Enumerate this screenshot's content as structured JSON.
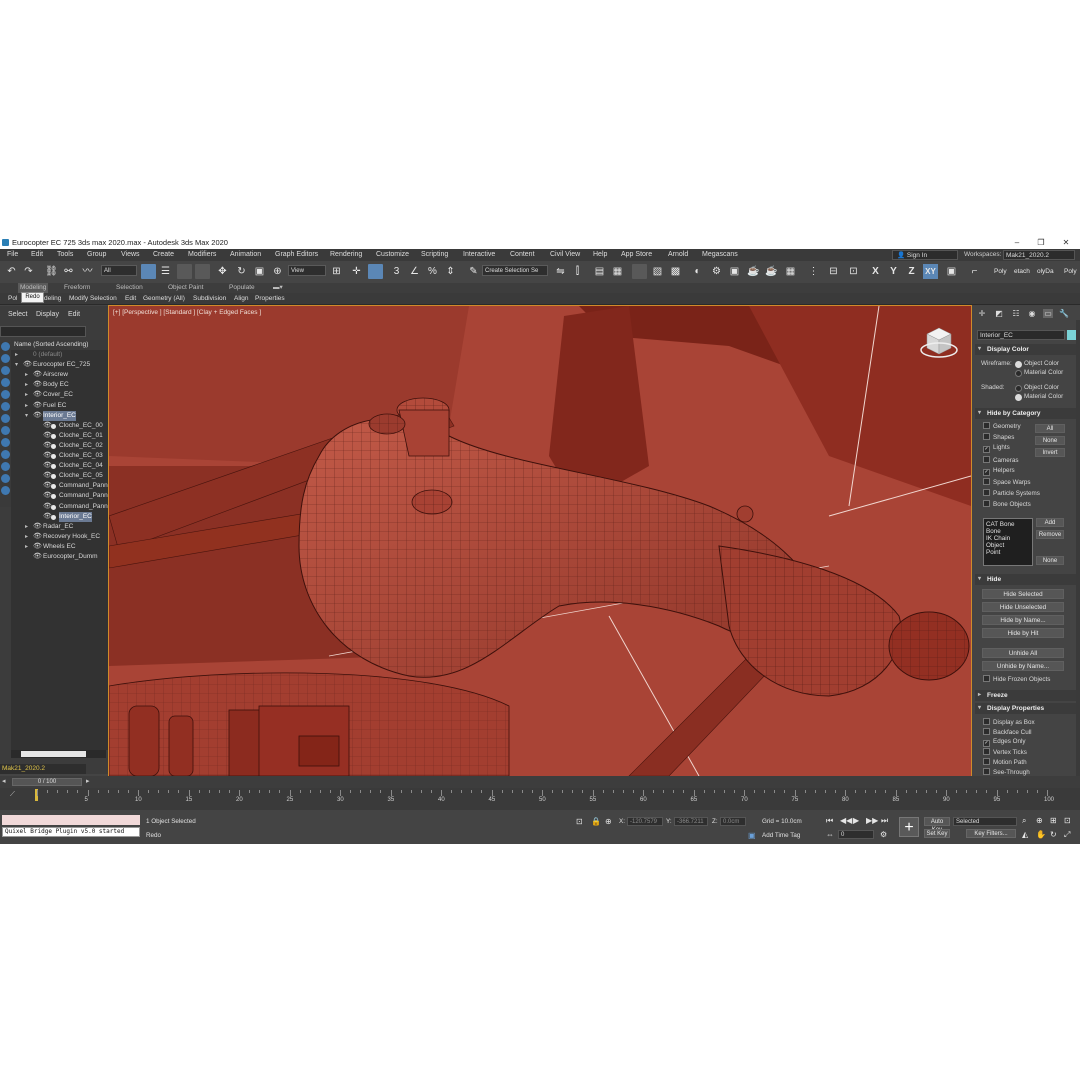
{
  "window": {
    "title": "Eurocopter EC 725 3ds max 2020.max - Autodesk 3ds Max 2020",
    "controls": [
      "‒",
      "❐",
      "✕"
    ]
  },
  "menu": {
    "items": [
      "File",
      "Edit",
      "Tools",
      "Group",
      "Views",
      "Create",
      "Modifiers",
      "Animation",
      "Graph Editors",
      "Rendering",
      "Customize",
      "Scripting",
      "Interactive",
      "Content",
      "Civil View",
      "Help",
      "App Store",
      "Arnold",
      "Megascans"
    ],
    "sign_in": "Sign In",
    "workspaces_label": "Workspaces:",
    "workspace_value": "Mak21_2020.2"
  },
  "toolbar": {
    "filter_value": "All",
    "refcoord_value": "View",
    "selection_set_placeholder": "Create Selection Se",
    "axis_labels": [
      "X",
      "Y",
      "Z",
      "XY"
    ],
    "right_items": [
      "Poly",
      "etach",
      "olyDa",
      "Poly"
    ]
  },
  "ribbon": {
    "tabs": [
      "Modeling",
      "Freeform",
      "Selection",
      "Object Paint",
      "Populate"
    ],
    "tooltip": "Redo",
    "subtabs": [
      "Pol",
      "deling",
      "Modify Selection",
      "Edit",
      "Geometry (All)",
      "Subdivision",
      "Align",
      "Properties"
    ]
  },
  "scene_explorer": {
    "menu": [
      "Select",
      "Display",
      "Edit"
    ],
    "header": "Name (Sorted Ascending)",
    "rows": [
      {
        "label": "0 (default)",
        "depth": 1,
        "arrow": "▸",
        "eye": false,
        "dim": true
      },
      {
        "label": "Eurocopter EC_725",
        "depth": 1,
        "arrow": "▾",
        "eye": true
      },
      {
        "label": "Airscrew",
        "depth": 2,
        "arrow": "▸",
        "eye": true
      },
      {
        "label": "Body EC",
        "depth": 2,
        "arrow": "▸",
        "eye": true
      },
      {
        "label": "Cover_EC",
        "depth": 2,
        "arrow": "▸",
        "eye": true
      },
      {
        "label": "Fuel EC",
        "depth": 2,
        "arrow": "▸",
        "eye": true
      },
      {
        "label": "Interior_EC",
        "depth": 2,
        "arrow": "▾",
        "eye": true,
        "selected": true
      },
      {
        "label": "Cloche_EC_00",
        "depth": 3,
        "eye": true
      },
      {
        "label": "Cloche_EC_01",
        "depth": 3,
        "eye": true
      },
      {
        "label": "Cloche_EC_02",
        "depth": 3,
        "eye": true
      },
      {
        "label": "Cloche_EC_03",
        "depth": 3,
        "eye": true
      },
      {
        "label": "Cloche_EC_04",
        "depth": 3,
        "eye": true
      },
      {
        "label": "Cloche_EC_05",
        "depth": 3,
        "eye": true
      },
      {
        "label": "Command_Pann",
        "depth": 3,
        "eye": true
      },
      {
        "label": "Command_Pann",
        "depth": 3,
        "eye": true
      },
      {
        "label": "Command_Pann",
        "depth": 3,
        "eye": true
      },
      {
        "label": "Interior_EC",
        "depth": 3,
        "eye": true,
        "selected": true
      },
      {
        "label": "Radar_EC",
        "depth": 2,
        "arrow": "▸",
        "eye": true
      },
      {
        "label": "Recovery Hook_EC",
        "depth": 2,
        "arrow": "▸",
        "eye": true
      },
      {
        "label": "Wheels EC",
        "depth": 2,
        "arrow": "▸",
        "eye": true
      },
      {
        "label": "Eurocopter_Dumm",
        "depth": 2,
        "eye": true
      }
    ],
    "layer_name": "Mak21_2020.2"
  },
  "viewport": {
    "label": "[+] [Perspective ] [Standard ] [Clay + Edged Faces ]",
    "clay_color": "#a94436"
  },
  "command_panel": {
    "object_name": "Interior_EC",
    "swatch_color": "#7ad3d6",
    "display_color": {
      "title": "Display Color",
      "wireframe_label": "Wireframe:",
      "shaded_label": "Shaded:",
      "object_color": "Object Color",
      "material_color": "Material Color"
    },
    "hide_by_category": {
      "title": "Hide by Category",
      "items": [
        {
          "label": "Geometry",
          "checked": false
        },
        {
          "label": "Shapes",
          "checked": false
        },
        {
          "label": "Lights",
          "checked": true
        },
        {
          "label": "Cameras",
          "checked": false
        },
        {
          "label": "Helpers",
          "checked": true
        },
        {
          "label": "Space Warps",
          "checked": false
        },
        {
          "label": "Particle Systems",
          "checked": false
        },
        {
          "label": "Bone Objects",
          "checked": false
        }
      ],
      "all": "All",
      "none": "None",
      "invert": "Invert",
      "list": [
        "CAT Bone",
        "Bone",
        "IK Chain Object",
        "Point"
      ],
      "add": "Add",
      "remove": "Remove",
      "none2": "None"
    },
    "hide": {
      "title": "Hide",
      "buttons": [
        "Hide Selected",
        "Hide Unselected",
        "Hide by Name...",
        "Hide by Hit",
        "Unhide All",
        "Unhide by Name..."
      ],
      "frozen": "Hide Frozen Objects"
    },
    "freeze": {
      "title": "Freeze"
    },
    "display_properties": {
      "title": "Display Properties",
      "items": [
        {
          "label": "Display as Box",
          "checked": false
        },
        {
          "label": "Backface Cull",
          "checked": false
        },
        {
          "label": "Edges Only",
          "checked": true
        },
        {
          "label": "Vertex Ticks",
          "checked": false
        },
        {
          "label": "Motion Path",
          "checked": false
        },
        {
          "label": "See-Through",
          "checked": false
        }
      ]
    }
  },
  "timeline": {
    "frame": "0 / 100",
    "ticks": [
      "5",
      "10",
      "15",
      "20",
      "25",
      "30",
      "35",
      "40",
      "45",
      "50",
      "55",
      "60",
      "65",
      "70",
      "75",
      "80",
      "85",
      "90",
      "95",
      "100"
    ]
  },
  "status": {
    "quixel": "Quixel Bridge Plugin v5.0 started",
    "selected": "1 Object Selected",
    "prompt": "Redo",
    "x_label": "X:",
    "x_value": "-120.7579",
    "y_label": "Y:",
    "y_value": "-366.7211",
    "z_label": "Z:",
    "z_value": "0.0cm",
    "grid": "Grid = 10.0cm",
    "add_time_tag": "Add Time Tag",
    "auto_key": "Auto Key",
    "set_key": "Set Key",
    "selected_value": "Selected",
    "key_filters": "Key Filters...",
    "frame_spin": "0"
  }
}
